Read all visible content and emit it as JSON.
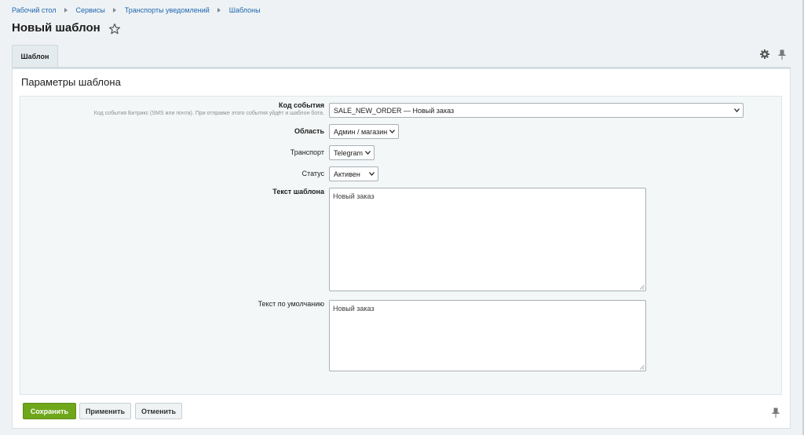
{
  "breadcrumb": {
    "items": [
      "Рабочий стол",
      "Сервисы",
      "Транспорты уведомлений",
      "Шаблоны"
    ]
  },
  "page": {
    "title": "Новый шаблон"
  },
  "tabs": [
    "Шаблон"
  ],
  "section": {
    "title": "Параметры шаблона"
  },
  "form": {
    "event_code": {
      "label": "Код события",
      "hint": "Код события Битрикс (SMS или почта). При отправке этого события уйдёт и шаблон бота.",
      "value": "SALE_NEW_ORDER — Новый заказ"
    },
    "area": {
      "label": "Область",
      "value": "Админ / магазин"
    },
    "transport": {
      "label": "Транспорт",
      "value": "Telegram"
    },
    "status": {
      "label": "Статус",
      "value": "Активен"
    },
    "template_text": {
      "label": "Текст шаблона",
      "value": "Новый заказ"
    },
    "default_text": {
      "label": "Текст по умолчанию",
      "value": "Новый заказ"
    }
  },
  "buttons": {
    "save": "Сохранить",
    "apply": "Применить",
    "cancel": "Отменить"
  },
  "colors": {
    "accent_green": "#6fa71b",
    "link_blue": "#2067b0"
  }
}
